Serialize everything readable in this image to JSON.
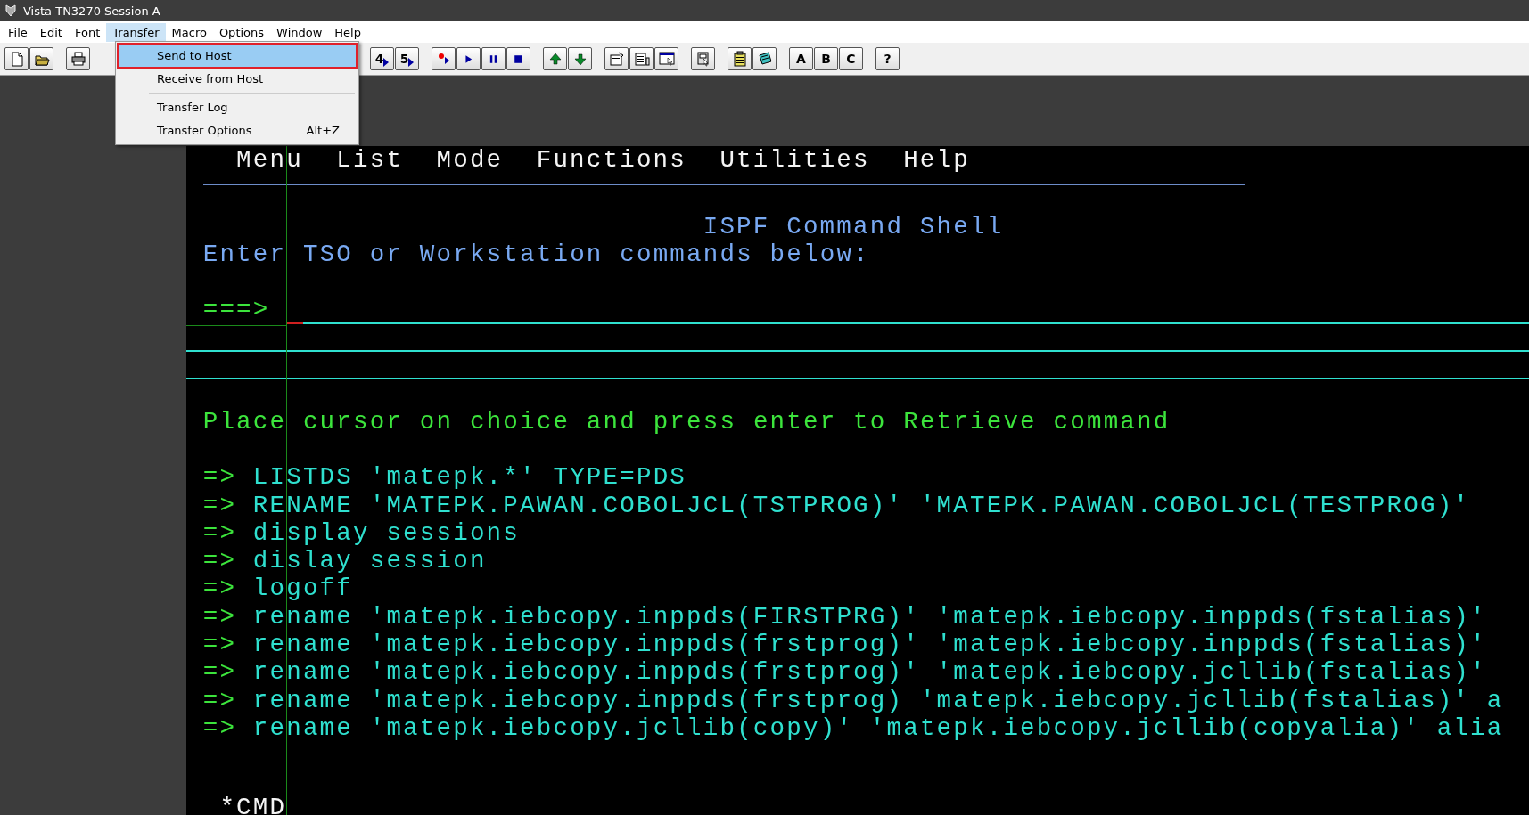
{
  "window": {
    "title": "Vista TN3270 Session A"
  },
  "menu_bar": [
    {
      "label": "File",
      "selected": false
    },
    {
      "label": "Edit",
      "selected": false
    },
    {
      "label": "Font",
      "selected": false
    },
    {
      "label": "Transfer",
      "selected": true
    },
    {
      "label": "Macro",
      "selected": false
    },
    {
      "label": "Options",
      "selected": false
    },
    {
      "label": "Window",
      "selected": false
    },
    {
      "label": "Help",
      "selected": false
    }
  ],
  "toolbar": [
    [
      {
        "kind": "icon"
      },
      {
        "kind": "icon"
      }
    ],
    [
      {
        "kind": "icon"
      }
    ],
    [
      {
        "kind": "macro",
        "label": "4"
      },
      {
        "kind": "macro",
        "label": "5"
      }
    ],
    [
      {
        "kind": "icon"
      },
      {
        "kind": "icon"
      },
      {
        "kind": "icon"
      },
      {
        "kind": "icon"
      }
    ],
    [
      {
        "kind": "icon"
      },
      {
        "kind": "icon"
      }
    ],
    [
      {
        "kind": "icon"
      },
      {
        "kind": "icon"
      },
      {
        "kind": "icon"
      }
    ],
    [
      {
        "kind": "icon"
      }
    ],
    [
      {
        "kind": "icon"
      },
      {
        "kind": "icon"
      }
    ],
    [
      {
        "kind": "label",
        "label": "A"
      },
      {
        "kind": "label",
        "label": "B"
      },
      {
        "kind": "label",
        "label": "C"
      }
    ],
    [
      {
        "kind": "label",
        "label": "?"
      }
    ]
  ],
  "transfer_menu": [
    {
      "kind": "item",
      "label": "Send to Host",
      "selected": true
    },
    {
      "kind": "item",
      "label": "Receive from Host",
      "selected": false
    },
    {
      "kind": "separator"
    },
    {
      "kind": "item",
      "label": "Transfer Log",
      "selected": false
    },
    {
      "kind": "item",
      "label": "Transfer Options",
      "shortcut": "Alt+Z",
      "selected": false
    }
  ],
  "terminal": {
    "action_bar": [
      "Menu",
      "List",
      "Mode",
      "Functions",
      "Utilities",
      "Help"
    ],
    "title": "ISPF Command Shell",
    "instruction": "Enter TSO or Workstation commands below:",
    "command_prompt": "===>",
    "retrieve_hint": "Place cursor on choice and press enter to Retrieve command",
    "history": [
      {
        "prompt": "=>",
        "text": "LISTDS 'matepk.*' TYPE=PDS"
      },
      {
        "prompt": "=>",
        "text": "RENAME 'MATEPK.PAWAN.COBOLJCL(TSTPROG)' 'MATEPK.PAWAN.COBOLJCL(TESTPROG)'"
      },
      {
        "prompt": "=>",
        "text": "display sessions"
      },
      {
        "prompt": "=>",
        "text": "dislay session"
      },
      {
        "prompt": "=>",
        "text": "logoff"
      },
      {
        "prompt": "=>",
        "text": "rename 'matepk.iebcopy.inppds(FIRSTPRG)' 'matepk.iebcopy.inppds(fstalias)'"
      },
      {
        "prompt": "=>",
        "text": "rename 'matepk.iebcopy.inppds(frstprog)' 'matepk.iebcopy.inppds(fstalias)'"
      },
      {
        "prompt": "=>",
        "text": "rename 'matepk.iebcopy.inppds(frstprog)' 'matepk.iebcopy.jcllib(fstalias)'"
      },
      {
        "prompt": "=>",
        "text": "rename 'matepk.iebcopy.inppds(frstprog) 'matepk.iebcopy.jcllib(fstalias)' a"
      },
      {
        "prompt": "=>",
        "text": "rename 'matepk.iebcopy.jcllib(copy)' 'matepk.iebcopy.jcllib(copyalia)' alia"
      }
    ],
    "status": "*CMD"
  }
}
